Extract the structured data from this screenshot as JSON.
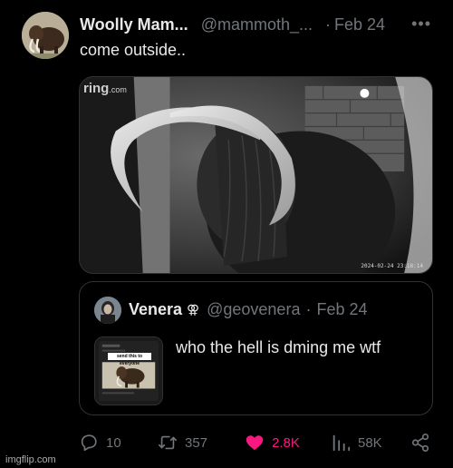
{
  "tweet": {
    "author_name": "Woolly Mam...",
    "author_handle": "@mammoth_...",
    "separator": "·",
    "date": "Feb 24",
    "more_label": "•••",
    "text": "come outside..",
    "media": {
      "logo": "ring",
      "logo_suffix": ".com",
      "camera_stamp": "2024-02-24 23:18:14"
    }
  },
  "quote": {
    "author_name": "Venera",
    "author_badge": "⚢",
    "author_handle": "@geovenera",
    "separator": "·",
    "date": "Feb 24",
    "text": "who the hell is dming me wtf",
    "thumbnail_caption": "send this to everyone"
  },
  "actions": {
    "replies": "10",
    "retweets": "357",
    "likes": "2.8K",
    "views": "58K",
    "like_color": "#f91880",
    "icons": [
      "reply-icon",
      "retweet-icon",
      "heart-icon",
      "views-icon",
      "share-icon"
    ]
  },
  "watermark": "imgflip.com"
}
